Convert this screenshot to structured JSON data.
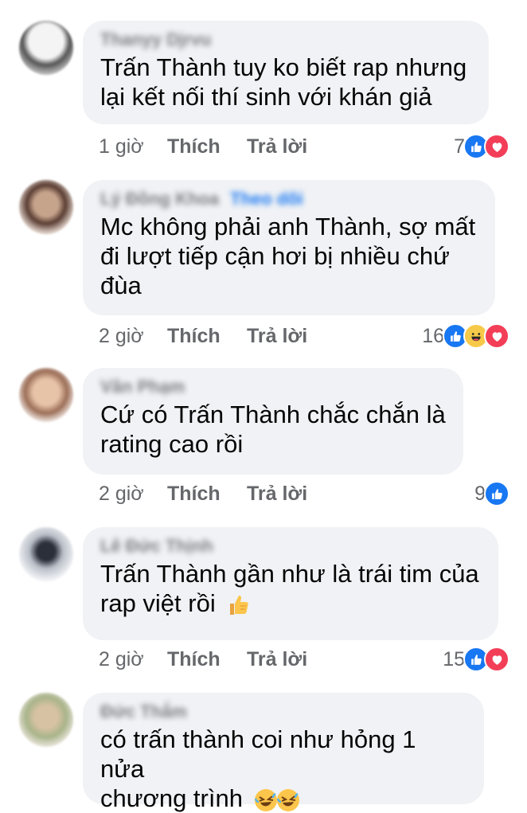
{
  "comments": [
    {
      "name": "Thanyy Djrvu",
      "follow": "",
      "lines": [
        "Trấn Thành tuy ko biết rap nhưng",
        "lại kết nối thí sinh với khán giả"
      ],
      "time": "1 giờ",
      "like_label": "Thích",
      "reply_label": "Trả lời",
      "reaction_count": "7",
      "reactions": [
        "like-icon",
        "love-icon"
      ]
    },
    {
      "name": "Lý Đồng Khoa",
      "follow": "Theo dõi",
      "lines": [
        "Mc không phải anh Thành, sợ mất",
        "đi lượt tiếp cận hơi bị nhiều chứ",
        "đùa"
      ],
      "time": "2 giờ",
      "like_label": "Thích",
      "reply_label": "Trả lời",
      "reaction_count": "16",
      "reactions": [
        "like-icon",
        "haha-icon",
        "love-icon"
      ]
    },
    {
      "name": "Vân Phạm",
      "follow": "",
      "lines": [
        "Cứ có Trấn Thành chắc chắn là",
        "rating cao rồi"
      ],
      "time": "2 giờ",
      "like_label": "Thích",
      "reply_label": "Trả lời",
      "reaction_count": "9",
      "reactions": [
        "like-icon"
      ]
    },
    {
      "name": "Lê Đức Thịnh",
      "follow": "",
      "lines": [
        "Trấn Thành gần như là trái tim của",
        "rap việt rồi"
      ],
      "time": "2 giờ",
      "like_label": "Thích",
      "reply_label": "Trả lời",
      "reaction_count": "15",
      "reactions": [
        "like-icon",
        "love-icon"
      ]
    },
    {
      "name": "Đức Thắm",
      "follow": "",
      "lines": [
        "có trấn thành coi như hỏng 1 nửa",
        "chương trình"
      ],
      "time": "",
      "like_label": "",
      "reply_label": "",
      "reaction_count": "",
      "reactions": []
    }
  ],
  "colors": {
    "like": "#1877f2",
    "love": "#f33e58",
    "haha": "#f7c948",
    "bubble": "#f0f2f5",
    "meta": "#65676b"
  }
}
